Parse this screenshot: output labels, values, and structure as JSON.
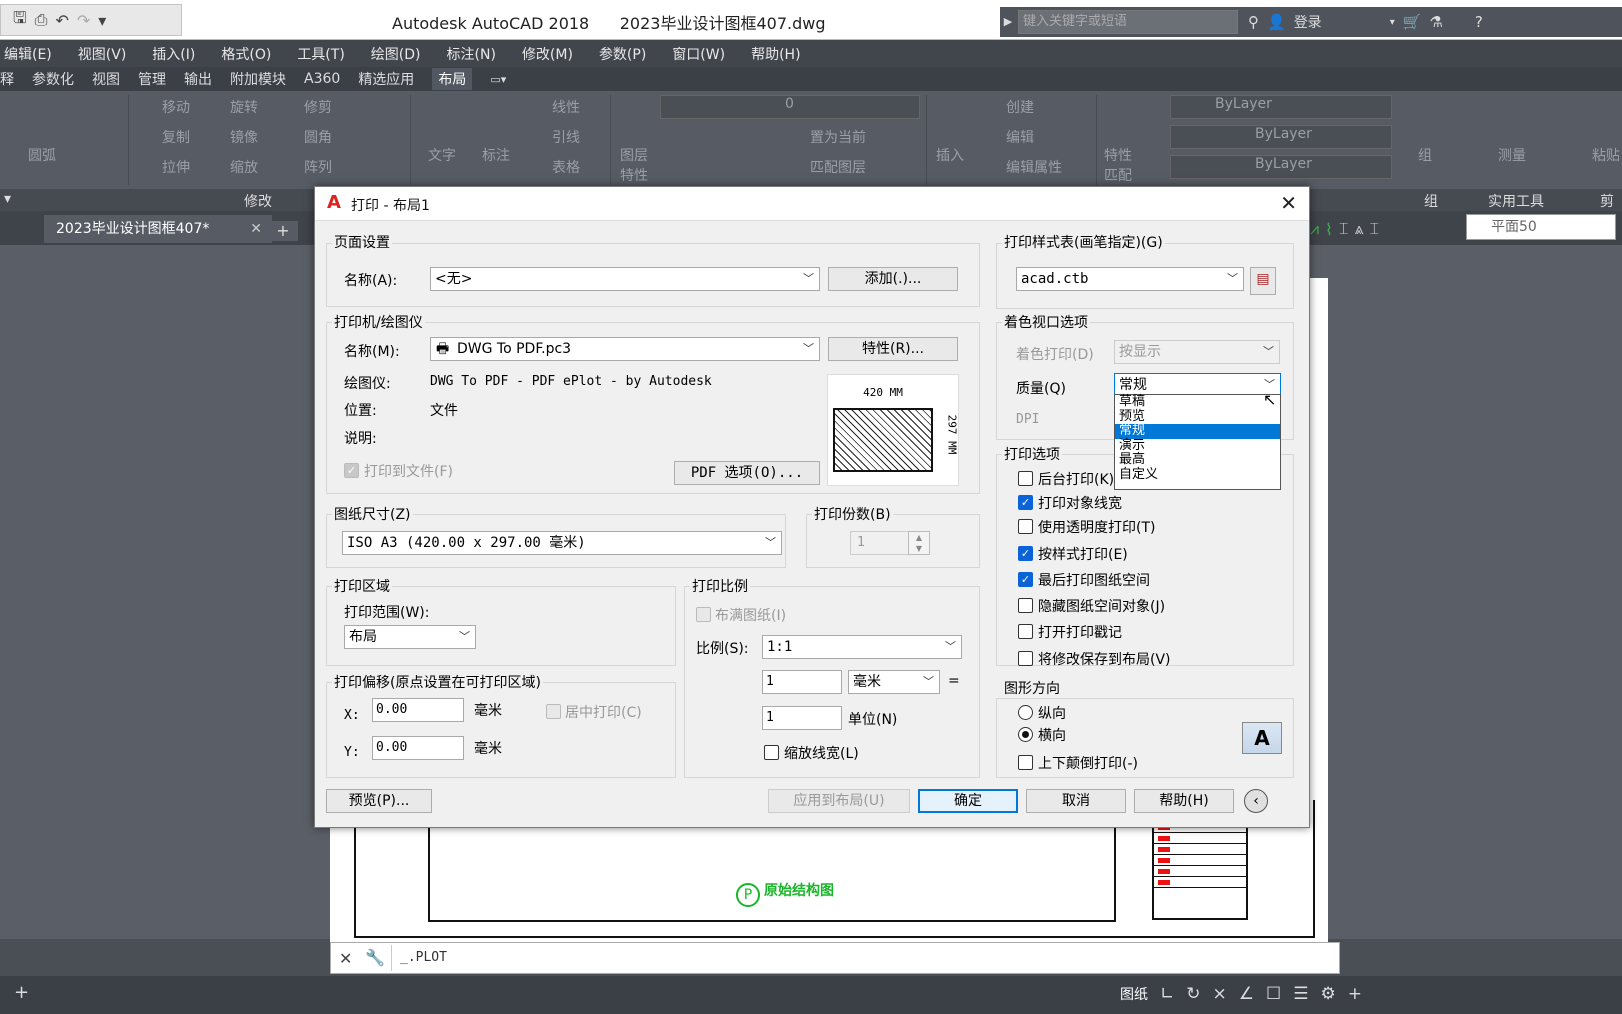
{
  "app": {
    "title": "Autodesk AutoCAD 2018      2023毕业设计图框407.dwg",
    "search_placeholder": "键入关键字或短语",
    "login": "登录"
  },
  "menubar": [
    "编辑(E)",
    "视图(V)",
    "插入(I)",
    "格式(O)",
    "工具(T)",
    "绘图(D)",
    "标注(N)",
    "修改(M)",
    "参数(P)",
    "窗口(W)",
    "帮助(H)"
  ],
  "ribbon_tabs": [
    "释",
    "参数化",
    "视图",
    "管理",
    "输出",
    "附加模块",
    "A360",
    "精选应用",
    "布局"
  ],
  "ribbon": {
    "draw": [
      "圆弧"
    ],
    "modify": [
      "移动",
      "旋转",
      "修剪",
      "复制",
      "镜像",
      "圆角",
      "拉伸",
      "缩放",
      "阵列"
    ],
    "annotation": [
      "文字",
      "标注",
      "线性",
      "引线",
      "表格"
    ],
    "layers": [
      "图层",
      "特性",
      "置为当前",
      "匹配图层"
    ],
    "layer_value": "0",
    "block": [
      "插入",
      "创建",
      "编辑",
      "编辑属性"
    ],
    "properties": [
      "特性",
      "匹配",
      "ByLayer",
      "ByLayer",
      "ByLayer"
    ],
    "groups": [
      "组"
    ],
    "utilities": [
      "测量"
    ],
    "clipboard": [
      "粘贴"
    ]
  },
  "panelbar": {
    "modify": "修改",
    "group": "组",
    "utilities": "实用工具",
    "clip": "剪"
  },
  "doc_tab": "2023毕业设计图框407*",
  "view_select": "平面50",
  "command_line": "_.PLOT",
  "statusbar": {
    "paper": "图纸"
  },
  "drawing": {
    "label": "原始结构图",
    "circle": "P"
  },
  "dialog": {
    "title": "打印 - 布局1",
    "page_setup": {
      "group": "页面设置",
      "name_label": "名称(A):",
      "name_value": "<无>",
      "add_button": "添加(.)..."
    },
    "printer": {
      "group": "打印机/绘图仪",
      "name_label": "名称(M):",
      "name_value": "DWG To PDF.pc3",
      "props_button": "特性(R)...",
      "plotter_label": "绘图仪:",
      "plotter_value": "DWG To PDF - PDF ePlot - by Autodesk",
      "location_label": "位置:",
      "location_value": "文件",
      "desc_label": "说明:",
      "print_to_file": "打印到文件(F)",
      "pdf_button": "PDF 选项(O)...",
      "dim_width": "420 MM",
      "dim_height": "297 MM"
    },
    "paper_size": {
      "group": "图纸尺寸(Z)",
      "value": "ISO A3 (420.00 x 297.00 毫米)"
    },
    "copies": {
      "group": "打印份数(B)",
      "value": "1"
    },
    "area": {
      "group": "打印区域",
      "range_label": "打印范围(W):",
      "range_value": "布局"
    },
    "offset": {
      "group": "打印偏移(原点设置在可打印区域)",
      "x_label": "X:",
      "x_value": "0.00",
      "y_label": "Y:",
      "y_value": "0.00",
      "unit": "毫米",
      "center": "居中打印(C)"
    },
    "scale": {
      "group": "打印比例",
      "fit": "布满图纸(I)",
      "ratio_label": "比例(S):",
      "ratio_value": "1:1",
      "val1": "1",
      "unit1": "毫米",
      "eq": "=",
      "val2": "1",
      "unit2": "单位(N)",
      "lineweights": "缩放线宽(L)"
    },
    "style_table": {
      "group": "打印样式表(画笔指定)(G)",
      "value": "acad.ctb"
    },
    "shaded": {
      "group": "着色视口选项",
      "shade_label": "着色打印(D)",
      "shade_value": "按显示",
      "quality_label": "质量(Q)",
      "quality_value": "常规",
      "dpi_label": "DPI",
      "options": [
        "草稿",
        "预览",
        "常规",
        "演示",
        "最高",
        "自定义"
      ],
      "selected_index": 2
    },
    "options": {
      "group": "打印选项",
      "items": [
        {
          "label": "后台打印(K)",
          "checked": false
        },
        {
          "label": "打印对象线宽",
          "checked": true
        },
        {
          "label": "使用透明度打印(T)",
          "checked": false
        },
        {
          "label": "按样式打印(E)",
          "checked": true
        },
        {
          "label": "最后打印图纸空间",
          "checked": true
        },
        {
          "label": "隐藏图纸空间对象(J)",
          "checked": false
        },
        {
          "label": "打开打印戳记",
          "checked": false
        },
        {
          "label": "将修改保存到布局(V)",
          "checked": false
        }
      ]
    },
    "orientation": {
      "group": "图形方向",
      "portrait": "纵向",
      "landscape": "横向",
      "upside": "上下颠倒打印(-)",
      "selected": "landscape",
      "icon_letter": "A"
    },
    "buttons": {
      "preview": "预览(P)...",
      "apply": "应用到布局(U)",
      "ok": "确定",
      "cancel": "取消",
      "help": "帮助(H)"
    }
  }
}
